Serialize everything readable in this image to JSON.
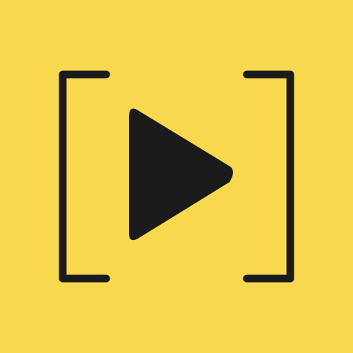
{
  "icon": {
    "name": "bracketed-play-app-icon",
    "glyphs": [
      "left-bracket-icon",
      "play-icon",
      "right-bracket-icon"
    ]
  },
  "colors": {
    "background": "#f8d84e",
    "foreground": "#1b1b1b"
  }
}
